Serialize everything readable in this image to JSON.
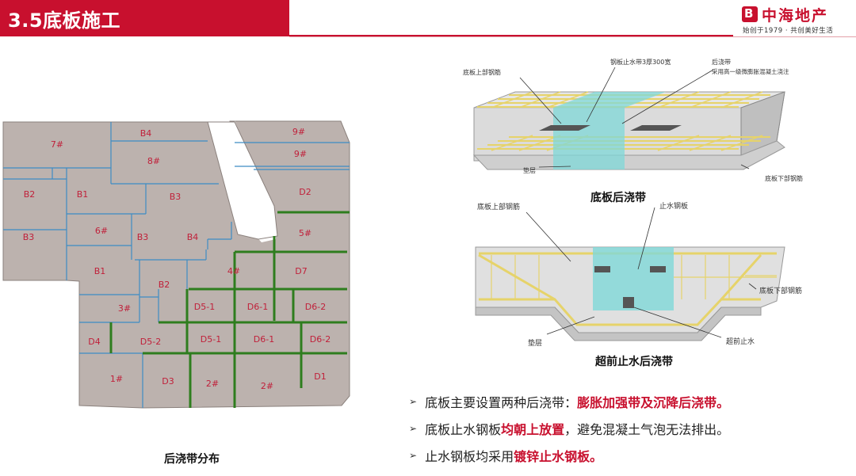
{
  "header": {
    "title": "3.5底板施工"
  },
  "logo": {
    "mark": "B",
    "name": "中海地产",
    "slogan": "始创于1979 · 共创美好生活"
  },
  "map": {
    "caption": "后浇带分布",
    "labels": [
      "7#",
      "B4",
      "9#",
      "8#",
      "9#",
      "B2",
      "B1",
      "B3",
      "D2",
      "B3",
      "6#",
      "B3",
      "B4",
      "5#",
      "B1",
      "4#",
      "D7",
      "B2",
      "3#",
      "D5-1",
      "D6-1",
      "D6-2",
      "D4",
      "D5-2",
      "D5-1",
      "D6-1",
      "D6-2",
      "1#",
      "D3",
      "2#",
      "2#",
      "D1"
    ]
  },
  "diagram1": {
    "caption": "底板后浇带",
    "labels": {
      "top_rebar": "底板上部钢筋",
      "waterstop": "钢板止水带3厚300宽",
      "pour_strip": "后浇带",
      "pour_note": "采用高一级微膨胀混凝土浇注",
      "cushion": "垫层",
      "bottom_rebar": "底板下部钢筋"
    }
  },
  "diagram2": {
    "caption": "超前止水后浇带",
    "labels": {
      "top_rebar": "底板上部钢筋",
      "waterstop": "止水钢板",
      "bottom_rebar": "底板下部钢筋",
      "cushion": "垫层",
      "advance": "超前止水"
    }
  },
  "bullets": [
    {
      "pre": "底板主要设置两种后浇带：",
      "hl": "膨胀加强带及沉降后浇带。",
      "post": ""
    },
    {
      "pre": "底板止水钢板",
      "hl": "均朝上放置",
      "post": "，避免混凝土气泡无法排出。"
    },
    {
      "pre": "止水钢板均采用",
      "hl": "镀锌止水钢板。",
      "post": ""
    }
  ],
  "colors": {
    "brand": "#c8102e",
    "map_fill": "#bcb2ae",
    "pour_strip_green": "#2e7d1e",
    "division_blue": "#3d8cc4",
    "label_red": "#c0203a"
  }
}
